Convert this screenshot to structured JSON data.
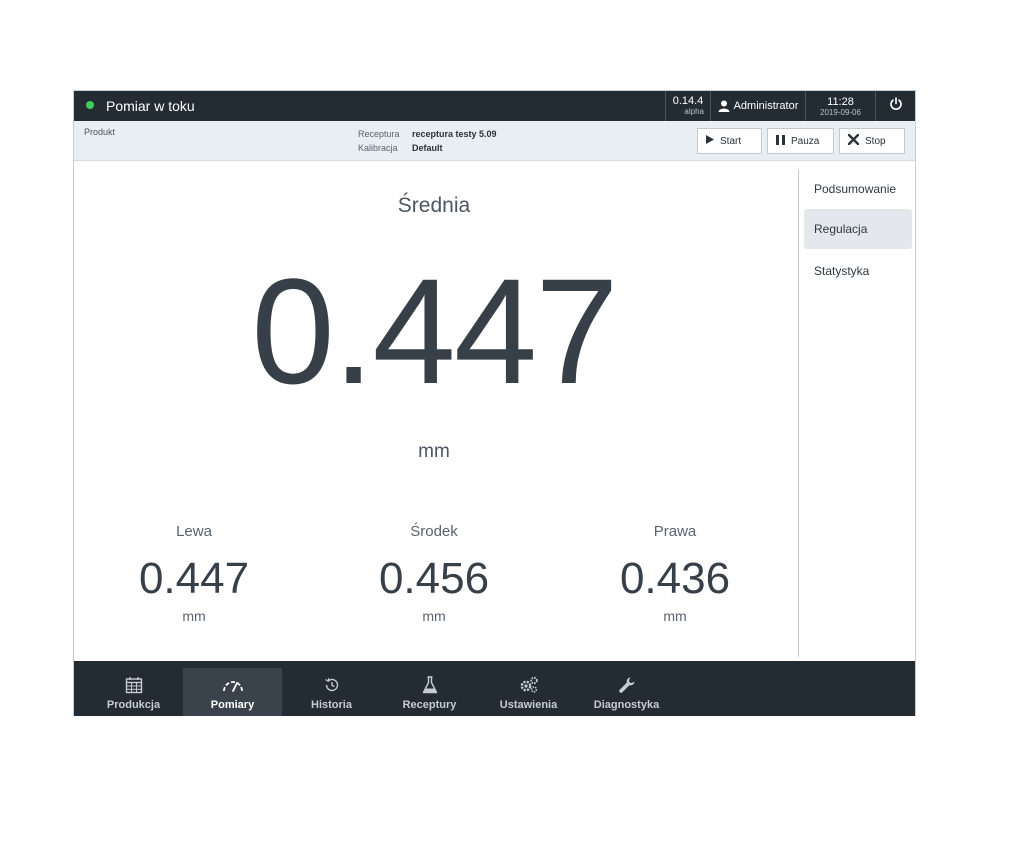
{
  "header": {
    "status_text": "Pomiar w toku",
    "status_color": "#3ecf5a",
    "version": "0.14.4",
    "version_channel": "alpha",
    "user": "Administrator",
    "time": "11:28",
    "date": "2019-09-06",
    "power_icon": "power-icon"
  },
  "infobar": {
    "product_label": "Produkt",
    "recipe_key": "Receptura",
    "recipe_value": "receptura testy 5.09",
    "calibration_key": "Kalibracja",
    "calibration_value": "Default",
    "buttons": {
      "start": "Start",
      "pause": "Pauza",
      "stop": "Stop"
    }
  },
  "main": {
    "average_label": "Średnia",
    "average_value": "0.447",
    "average_unit": "mm",
    "sections": [
      {
        "label": "Lewa",
        "value": "0.447",
        "unit": "mm"
      },
      {
        "label": "Środek",
        "value": "0.456",
        "unit": "mm"
      },
      {
        "label": "Prawa",
        "value": "0.436",
        "unit": "mm"
      }
    ]
  },
  "sidepanel": {
    "items": [
      {
        "label": "Podsumowanie",
        "active": false
      },
      {
        "label": "Regulacja",
        "active": true
      },
      {
        "label": "Statystyka",
        "active": false
      }
    ]
  },
  "bottomnav": {
    "items": [
      {
        "label": "Produkcja",
        "icon": "calendar-icon",
        "active": false
      },
      {
        "label": "Pomiary",
        "icon": "gauge-icon",
        "active": true
      },
      {
        "label": "Historia",
        "icon": "history-icon",
        "active": false
      },
      {
        "label": "Receptury",
        "icon": "flask-icon",
        "active": false
      },
      {
        "label": "Ustawienia",
        "icon": "gears-icon",
        "active": false
      },
      {
        "label": "Diagnostyka",
        "icon": "wrench-icon",
        "active": false
      }
    ]
  },
  "colors": {
    "topbar_bg": "#232b33",
    "infobar_bg": "#e9eef3",
    "value_text": "#373f48",
    "active_nav_bg": "#3a434c"
  }
}
